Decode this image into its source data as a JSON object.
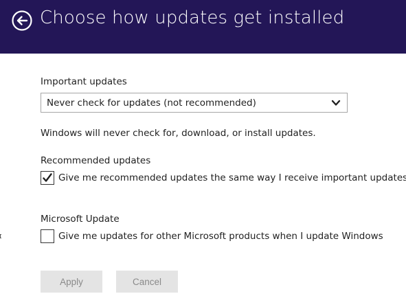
{
  "header": {
    "title": "Choose how updates get installed",
    "back_icon": "back-arrow-circle-icon",
    "background": "#231657"
  },
  "important_updates": {
    "label": "Important updates",
    "selected": "Never check for updates (not recommended)",
    "description": "Windows will never check for, download, or install updates."
  },
  "recommended_updates": {
    "label": "Recommended updates",
    "checkbox_label": "Give me recommended updates the same way I receive important updates",
    "checked": true
  },
  "microsoft_update": {
    "label": "Microsoft Update",
    "checkbox_label": "Give me updates for other Microsoft products when I update Windows",
    "checked": false
  },
  "buttons": {
    "apply": "Apply",
    "cancel": "Cancel",
    "disabled_color": "#8a8a8a"
  }
}
